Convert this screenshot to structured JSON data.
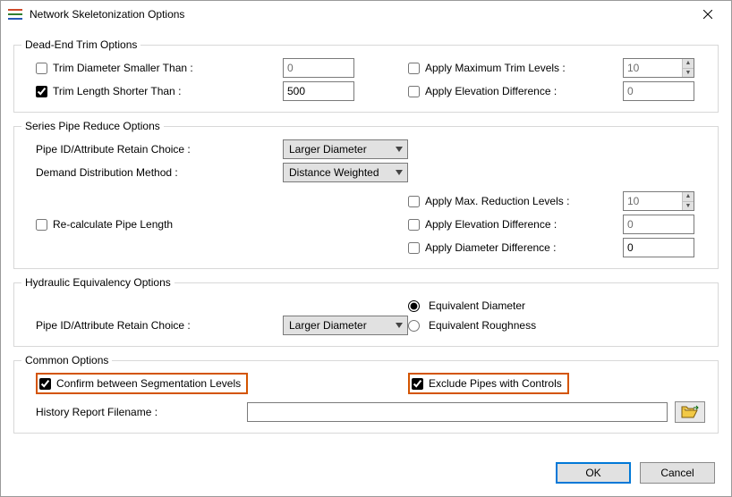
{
  "window": {
    "title": "Network Skeletonization Options"
  },
  "groups": {
    "deadend": {
      "legend": "Dead-End Trim Options",
      "trimDiameter": {
        "label": "Trim Diameter Smaller Than :",
        "checked": false,
        "value": "0"
      },
      "trimLength": {
        "label": "Trim Length Shorter Than :",
        "checked": true,
        "value": "500"
      },
      "applyMaxTrim": {
        "label": "Apply Maximum Trim Levels :",
        "checked": false,
        "value": "10"
      },
      "applyElevDiff": {
        "label": "Apply Elevation Difference :",
        "checked": false,
        "value": "0"
      }
    },
    "series": {
      "legend": "Series Pipe Reduce Options",
      "pipeRetainLabel": "Pipe ID/Attribute Retain Choice :",
      "pipeRetainValue": "Larger Diameter",
      "demandLabel": "Demand Distribution Method :",
      "demandValue": "Distance Weighted",
      "recalc": {
        "label": "Re-calculate Pipe Length",
        "checked": false
      },
      "applyMaxRed": {
        "label": "Apply Max. Reduction Levels :",
        "checked": false,
        "value": "10"
      },
      "applyElevDiff": {
        "label": "Apply Elevation Difference :",
        "checked": false,
        "value": "0"
      },
      "applyDiamDiff": {
        "label": "Apply Diameter Difference :",
        "checked": false,
        "value": "0"
      }
    },
    "hydraulic": {
      "legend": "Hydraulic Equivalency Options",
      "pipeRetainLabel": "Pipe ID/Attribute Retain Choice :",
      "pipeRetainValue": "Larger Diameter",
      "equivDiameter": "Equivalent Diameter",
      "equivRoughness": "Equivalent Roughness"
    },
    "common": {
      "legend": "Common Options",
      "confirm": {
        "label": "Confirm between Segmentation Levels",
        "checked": true
      },
      "exclude": {
        "label": "Exclude Pipes with Controls",
        "checked": true
      },
      "historyLabel": "History Report Filename :",
      "historyValue": ""
    }
  },
  "buttons": {
    "ok": "OK",
    "cancel": "Cancel"
  }
}
